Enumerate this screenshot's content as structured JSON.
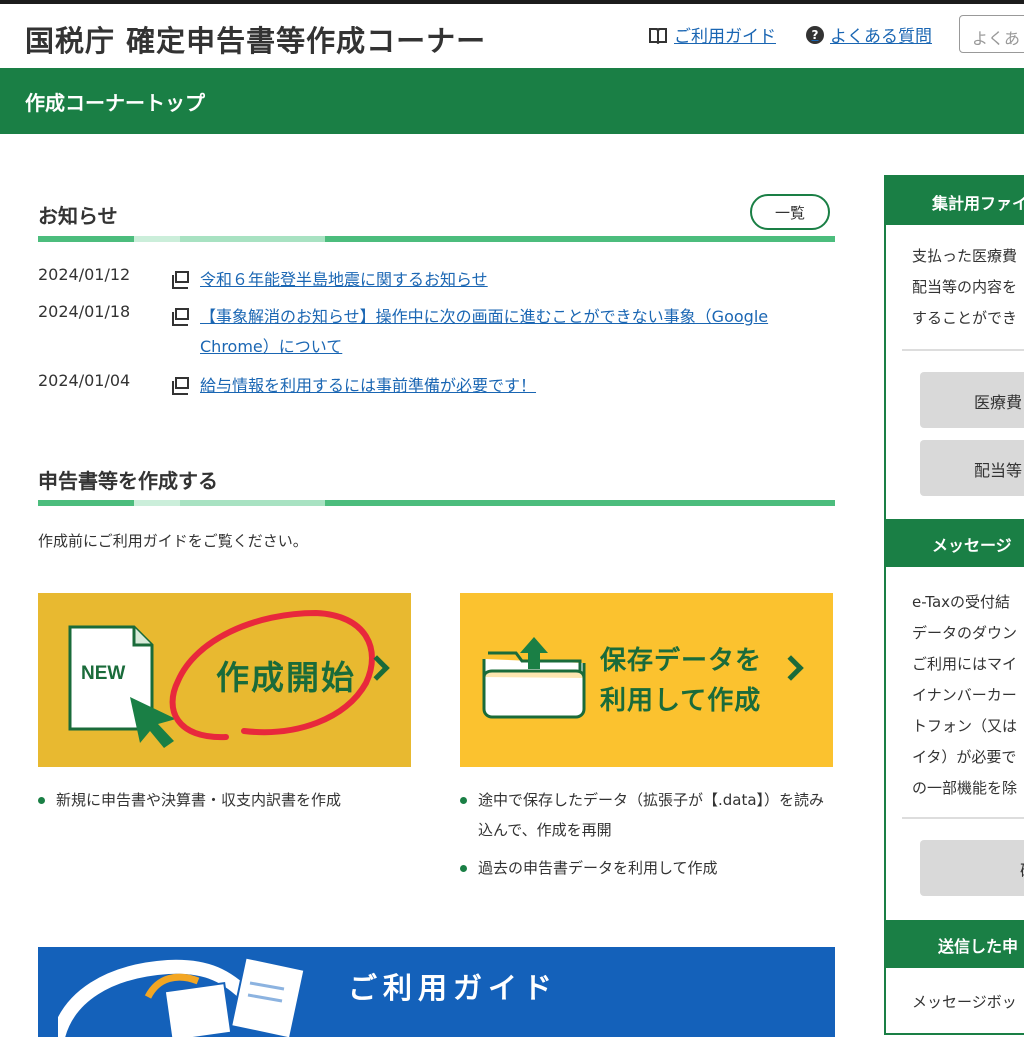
{
  "header": {
    "title": "国税庁 確定申告書等作成コーナー",
    "guide_link": "ご利用ガイド",
    "faq_link": "よくある質問",
    "search_placeholder": "よくあ"
  },
  "nav": {
    "title": "作成コーナートップ"
  },
  "news": {
    "title": "お知らせ",
    "list_button": "一覧",
    "items": [
      {
        "date": "2024/01/12",
        "text": "令和６年能登半島地震に関するお知らせ"
      },
      {
        "date": "2024/01/18",
        "text": "【事象解消のお知らせ】操作中に次の画面に進むことができない事象（Google Chrome）について"
      },
      {
        "date": "2024/01/04",
        "text": "給与情報を利用するには事前準備が必要です！"
      }
    ]
  },
  "create": {
    "title": "申告書等を作成する",
    "intro": "作成前にご利用ガイドをご覧ください。",
    "start": {
      "badge": "NEW",
      "label": "作成開始",
      "bullets": [
        "新規に申告書や決算書・収支内訳書を作成"
      ]
    },
    "load": {
      "label_line1": "保存データを",
      "label_line2": "利用して作成",
      "bullets": [
        "途中で保存したデータ（拡張子が【.data】）を読み込んで、作成を再開",
        "過去の申告書データを利用して作成"
      ]
    }
  },
  "guide_banner": {
    "title": "ご利用ガイド"
  },
  "sidebar": {
    "section1": {
      "head": "集計用ファイ",
      "lines": [
        "支払った医療費",
        "配当等の内容を",
        "することができ"
      ],
      "buttons": [
        "医療費",
        "配当等"
      ]
    },
    "section2": {
      "head": "メッセージ",
      "lines": [
        "e-Taxの受付結",
        "データのダウン",
        "ご利用にはマイ",
        "イナンバーカー",
        "トフォン（又は",
        "イタ）が必要で",
        "の一部機能を除"
      ],
      "button": "確"
    },
    "section3": {
      "head": "送信した申",
      "lines": [
        "メッセージボッ"
      ]
    }
  },
  "colors": {
    "brand_green": "#1a7f45",
    "accent_green": "#4cbd7d",
    "card_yellow": "#fbc22f",
    "card_yellow_dark": "#e8b930",
    "link_blue": "#1a66b3",
    "banner_blue": "#1461ba",
    "annotation_red": "#e8283c"
  }
}
